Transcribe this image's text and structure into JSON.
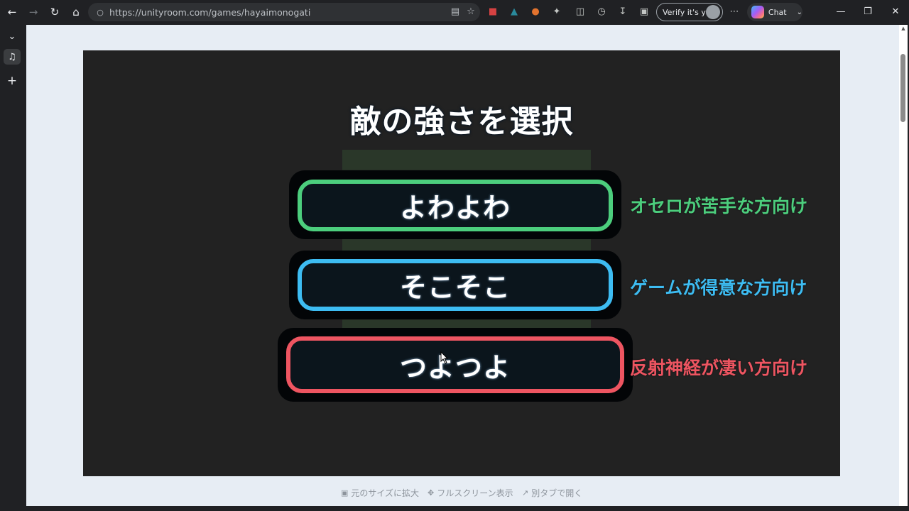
{
  "browser": {
    "url": "https://unityroom.com/games/hayaimonogati",
    "verify_label": "Verify it's you",
    "chat_label": "Chat"
  },
  "game": {
    "title": "敵の強さを選択",
    "options": [
      {
        "label": "よわよわ",
        "description": "オセロが苦手な方向け",
        "color": "#4cce7d"
      },
      {
        "label": "そこそこ",
        "description": "ゲームが得意な方向け",
        "color": "#3dbcf2"
      },
      {
        "label": "つよつよ",
        "description": "反射神経が凄い方向け",
        "color": "#ee5561"
      }
    ]
  },
  "footer": {
    "expand_label": "元のサイズに拡大",
    "fullscreen_label": "フルスクリーン表示",
    "newtab_label": "別タブで開く"
  }
}
